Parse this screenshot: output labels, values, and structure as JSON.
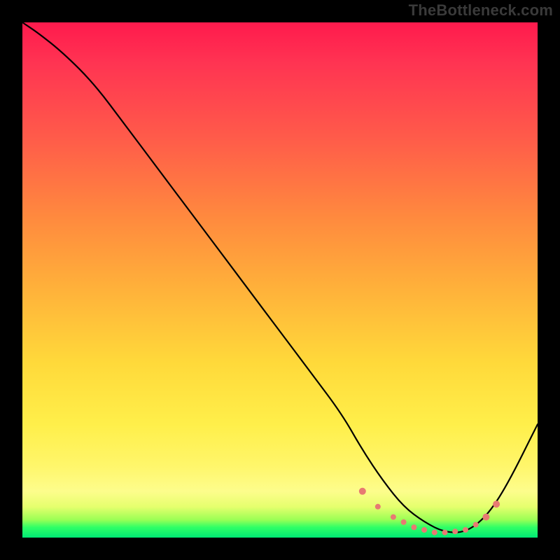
{
  "attribution": "TheBottleneck.com",
  "colors": {
    "frame": "#000000",
    "attribution_text": "#3a3a3a",
    "curve": "#000000",
    "marker": "#e77a72"
  },
  "chart_data": {
    "type": "line",
    "title": "",
    "xlabel": "",
    "ylabel": "",
    "xlim": [
      0,
      100
    ],
    "ylim": [
      0,
      100
    ],
    "grid": false,
    "legend": null,
    "series": [
      {
        "name": "bottleneck-curve",
        "x": [
          0,
          3,
          8,
          14,
          20,
          26,
          32,
          38,
          44,
          50,
          56,
          62,
          66,
          70,
          74,
          78,
          82,
          86,
          90,
          94,
          100
        ],
        "values": [
          100,
          98,
          94,
          88,
          80,
          72,
          64,
          56,
          48,
          40,
          32,
          24,
          17,
          11,
          6,
          3,
          1,
          1,
          4,
          10,
          22
        ]
      }
    ],
    "markers": {
      "name": "highlight-dots",
      "x": [
        66,
        69,
        72,
        74,
        76,
        78,
        80,
        82,
        84,
        86,
        88,
        90,
        92
      ],
      "values": [
        9,
        6,
        4,
        3,
        2,
        1.5,
        1,
        1,
        1.2,
        1.5,
        2.5,
        4,
        6.5
      ],
      "radius": [
        5,
        4,
        4,
        4,
        4,
        4,
        4,
        4,
        4,
        4,
        4,
        5,
        5
      ]
    }
  }
}
